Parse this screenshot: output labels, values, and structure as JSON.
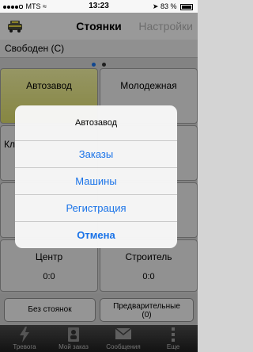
{
  "status_bar": {
    "carrier": "MTS",
    "time": "13:23",
    "battery": "83 %"
  },
  "nav": {
    "title": "Стоянки",
    "settings": "Настройки"
  },
  "segment": {
    "label": "Свободен (С)"
  },
  "tiles": [
    {
      "name": "Автозавод",
      "count": "",
      "active": true
    },
    {
      "name": "Молодежная",
      "count": "",
      "active": false
    },
    {
      "name": "Кл",
      "count": "",
      "active": false
    },
    {
      "name": "Центр",
      "count": "0:0",
      "active": false
    },
    {
      "name": "Строитель",
      "count": "0:0",
      "active": false
    }
  ],
  "alert": {
    "title": "Автозавод",
    "buttons": [
      "Заказы",
      "Машины",
      "Регистрация",
      "Отмена"
    ]
  },
  "bottom_buttons": {
    "no_stands": "Без стоянок",
    "preliminary_line1": "Предварительные",
    "preliminary_line2": "(0)"
  },
  "tabs": [
    {
      "label": "Тревога",
      "icon": "lightning-icon"
    },
    {
      "label": "Мой заказ",
      "icon": "person-card-icon"
    },
    {
      "label": "Сообщения",
      "icon": "envelope-icon"
    },
    {
      "label": "Еще",
      "icon": "more-icon"
    }
  ],
  "colors": {
    "accent": "#1a73e8",
    "active_tile": "#e8e88a"
  }
}
